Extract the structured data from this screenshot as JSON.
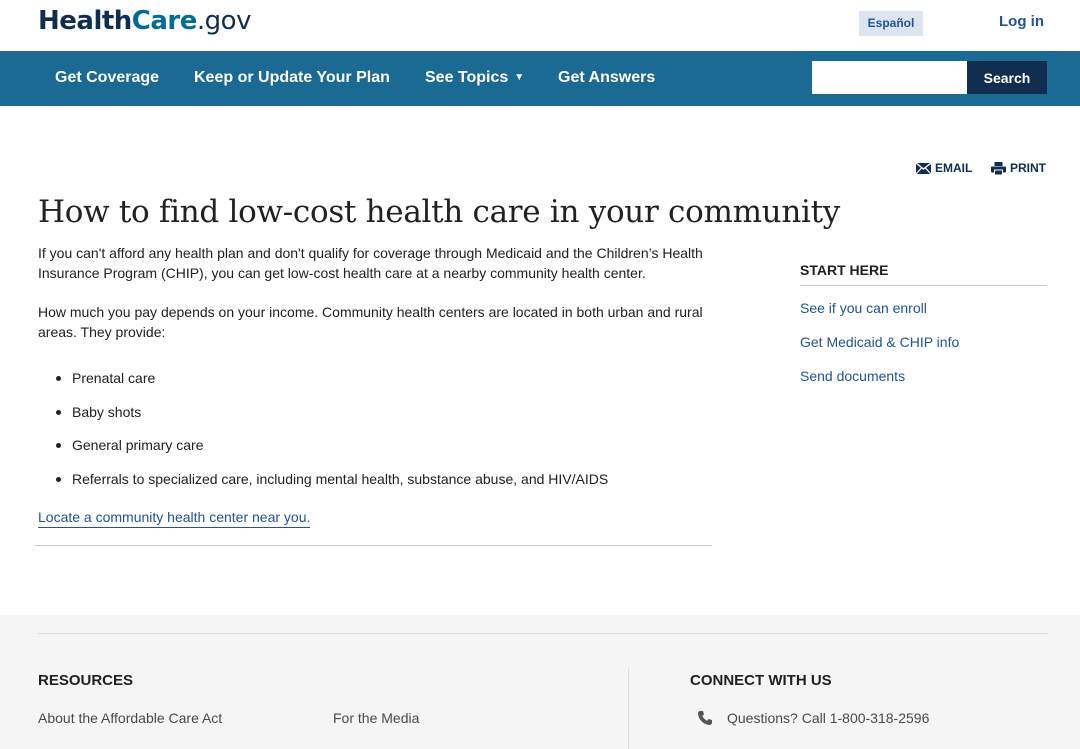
{
  "header": {
    "logo": {
      "part1": "Health",
      "part2": "Care",
      "part3": ".gov"
    },
    "espanol_label": "Español",
    "login_label": "Log in"
  },
  "nav": {
    "items": [
      {
        "label": "Get Coverage"
      },
      {
        "label": "Keep or Update Your Plan"
      },
      {
        "label": "See Topics"
      },
      {
        "label": "Get Answers"
      }
    ],
    "search": {
      "value": "",
      "placeholder": "",
      "button_label": "Search"
    }
  },
  "utility": {
    "email_label": "EMAIL",
    "print_label": "PRINT"
  },
  "main": {
    "title": "How to find low-cost health care in your community",
    "paragraph1": "If you can't afford any health plan and don't qualify for coverage through Medicaid and the Children’s Health Insurance Program (CHIP), you can get low-cost health care at a nearby community health center.",
    "paragraph2": "How much you pay depends on your income. Community health centers are located in both urban and rural areas. They provide:",
    "bullets": [
      "Prenatal care",
      "Baby shots",
      "General primary care",
      "Referrals to specialized care, including mental health, substance abuse, and HIV/AIDS"
    ],
    "locate_link": "Locate a community health center near you."
  },
  "sidebar": {
    "title": "START HERE",
    "links": [
      "See if you can enroll",
      "Get Medicaid & CHIP info",
      "Send documents"
    ]
  },
  "footer": {
    "resources_title": "RESOURCES",
    "resources_links": [
      "About the Affordable Care Act",
      "For the Media"
    ],
    "connect_title": "CONNECT WITH US",
    "phone_text": "Questions? Call 1-800-318-2596"
  },
  "colors": {
    "nav_bg": "#1b6a94",
    "brand_dark": "#112e51",
    "brand_blue": "#046b99",
    "link": "#205493",
    "footer_bg": "#f5f5f5"
  }
}
